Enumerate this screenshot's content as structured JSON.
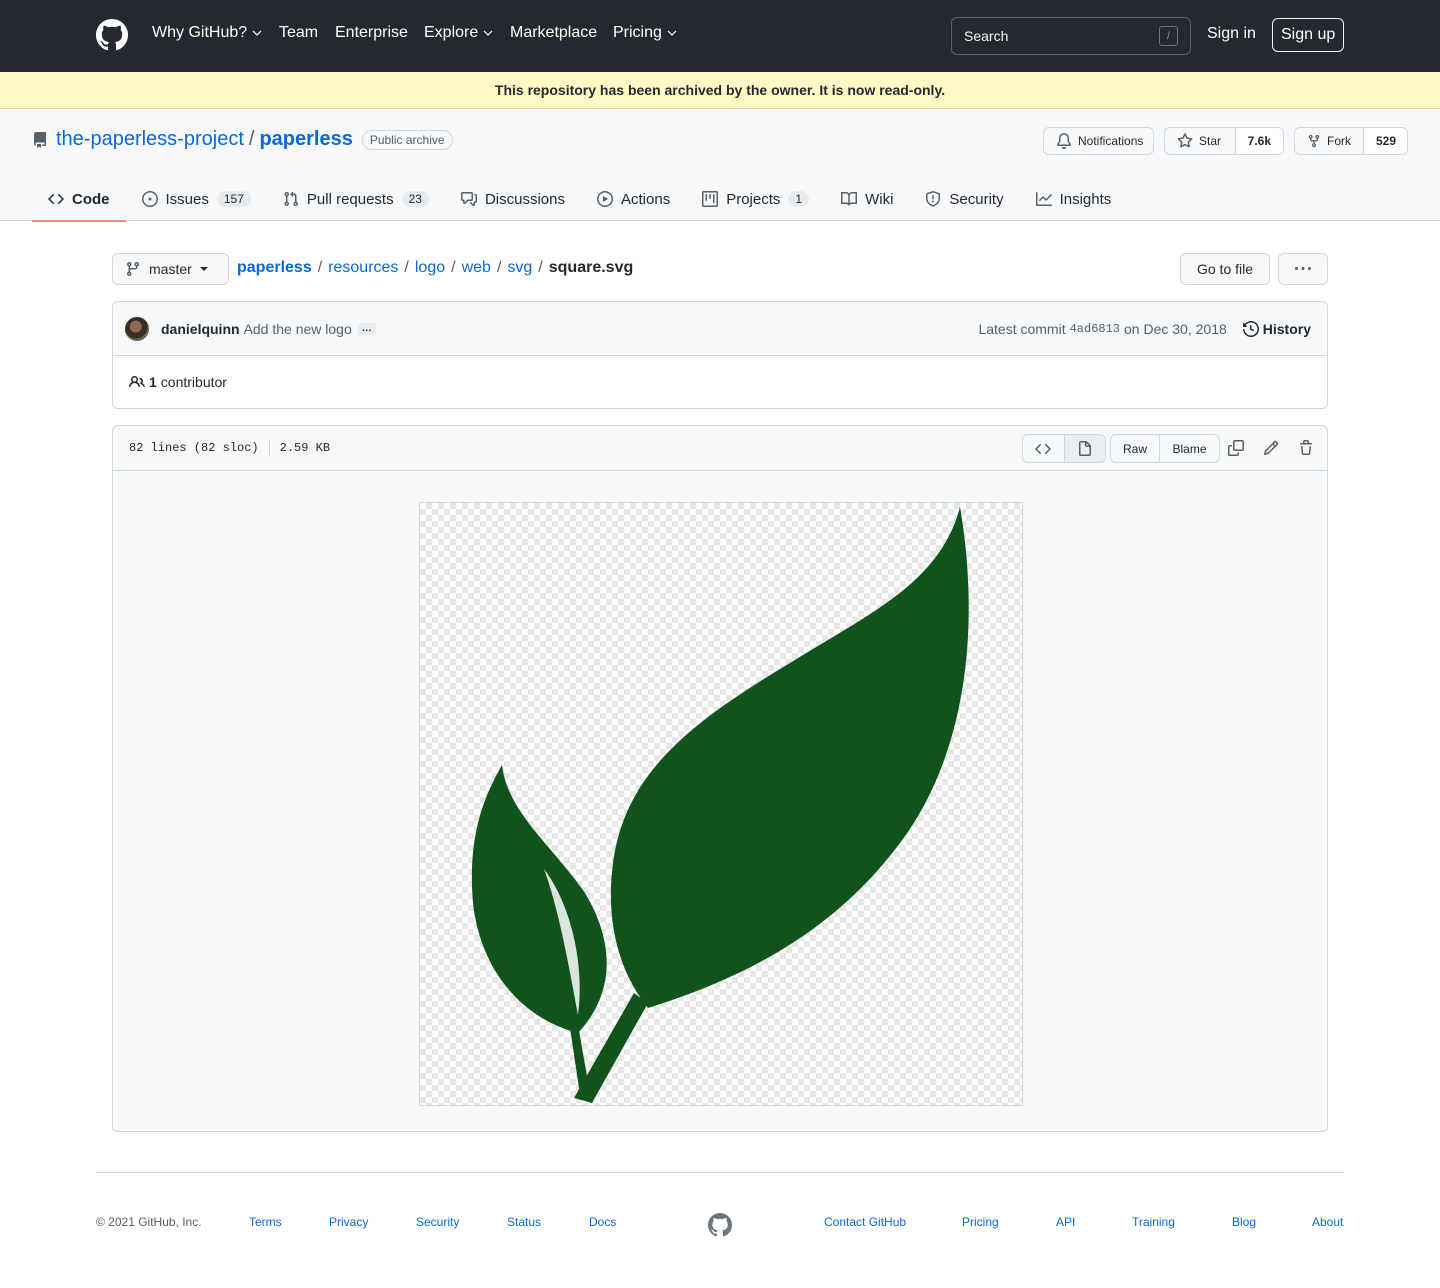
{
  "header": {
    "nav": [
      "Why GitHub?",
      "Team",
      "Enterprise",
      "Explore",
      "Marketplace",
      "Pricing"
    ],
    "search_placeholder": "Search",
    "search_key": "/",
    "sign_in": "Sign in",
    "sign_up": "Sign up"
  },
  "banner": "This repository has been archived by the owner. It is now read-only.",
  "repo": {
    "owner": "the-paperless-project",
    "separator": "/",
    "name": "paperless",
    "label": "Public archive",
    "notifications": "Notifications",
    "star": "Star",
    "star_count": "7.6k",
    "fork": "Fork",
    "fork_count": "529"
  },
  "tabs": [
    {
      "label": "Code",
      "icon": "code-icon",
      "active": true
    },
    {
      "label": "Issues",
      "icon": "issue-icon",
      "counter": "157"
    },
    {
      "label": "Pull requests",
      "icon": "pull-request-icon",
      "counter": "23"
    },
    {
      "label": "Discussions",
      "icon": "discussions-icon"
    },
    {
      "label": "Actions",
      "icon": "play-icon"
    },
    {
      "label": "Projects",
      "icon": "project-icon",
      "counter": "1"
    },
    {
      "label": "Wiki",
      "icon": "book-icon"
    },
    {
      "label": "Security",
      "icon": "shield-icon"
    },
    {
      "label": "Insights",
      "icon": "graph-icon"
    }
  ],
  "file_nav": {
    "branch": "master",
    "path": [
      "paperless",
      "resources",
      "logo",
      "web",
      "svg"
    ],
    "filename": "square.svg",
    "go_to_file": "Go to file",
    "more": "···"
  },
  "commit": {
    "author": "danielquinn",
    "message": "Add the new logo",
    "ellipsis": "…",
    "latest_label": "Latest commit",
    "sha": "4ad6813",
    "date": "on Dec 30, 2018",
    "history": "History",
    "contributors_count": "1",
    "contributors_label": "contributor"
  },
  "file": {
    "lines": "82 lines (82 sloc)",
    "size": "2.59 KB",
    "raw": "Raw",
    "blame": "Blame",
    "leaf_color": "#11531c"
  },
  "footer": {
    "copyright": "© 2021 GitHub, Inc.",
    "links_left": [
      "Terms",
      "Privacy",
      "Security",
      "Status",
      "Docs"
    ],
    "links_right": [
      "Contact GitHub",
      "Pricing",
      "API",
      "Training",
      "Blog",
      "About"
    ]
  },
  "colors": {
    "header_bg": "#24292f",
    "link": "#0969da",
    "banner_bg": "#fff8c5",
    "active_tab_underline": "#fd8c73"
  }
}
